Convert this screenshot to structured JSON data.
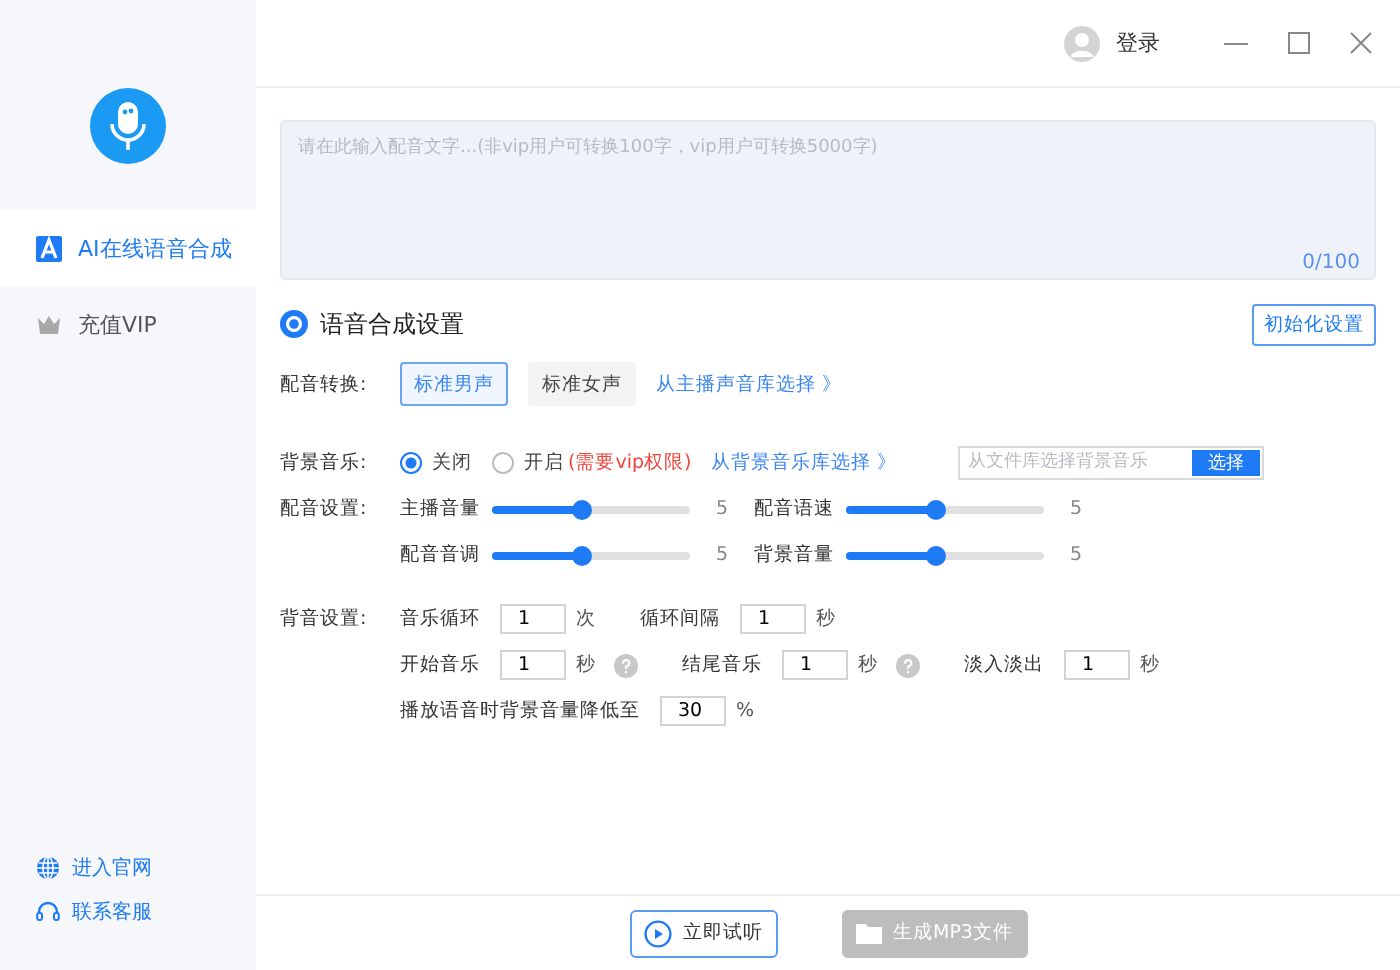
{
  "header": {
    "login": "登录"
  },
  "sidebar": {
    "items": [
      {
        "label": "AI在线语音合成",
        "selected": true,
        "kind": "ai"
      },
      {
        "label": "充值VIP",
        "selected": false,
        "kind": "vip"
      }
    ],
    "links": [
      {
        "label": "进入官网",
        "kind": "globe"
      },
      {
        "label": "联系客服",
        "kind": "headset"
      }
    ]
  },
  "editor": {
    "placeholder": "请在此输入配音文字...(非vip用户可转换100字，vip用户可转换5000字)",
    "counter": "0/100"
  },
  "settings": {
    "title": "语音合成设置",
    "reset": "初始化设置",
    "voice": {
      "label": "配音转换:",
      "options": [
        {
          "label": "标准男声",
          "selected": true
        },
        {
          "label": "标准女声",
          "selected": false
        }
      ],
      "link": "从主播声音库选择 》"
    },
    "music": {
      "label": "背景音乐:",
      "options": [
        {
          "label": "关闭",
          "selected": true
        },
        {
          "label": "开启",
          "selected": false,
          "note": "(需要vip权限)"
        }
      ],
      "link": "从背景音乐库选择 》",
      "file_placeholder": "从文件库选择背景音乐",
      "choose": "选择"
    },
    "mix": {
      "label": "配音设置:",
      "rows": [
        [
          {
            "name": "主播音量",
            "level": 0.45,
            "reading": "5"
          },
          {
            "name": "配音语速",
            "level": 0.45,
            "reading": "5"
          }
        ],
        [
          {
            "name": "配音音调",
            "level": 0.45,
            "reading": "5"
          },
          {
            "name": "背景音量",
            "level": 0.45,
            "reading": "5"
          }
        ]
      ]
    },
    "bg": {
      "label": "背音设置:",
      "rows": [
        [
          {
            "label": "音乐循环",
            "value": "1",
            "unit": "次",
            "help": false
          },
          {
            "label": "循环间隔",
            "value": "1",
            "unit": "秒",
            "help": false
          }
        ],
        [
          {
            "label": "开始音乐",
            "value": "1",
            "unit": "秒",
            "help": true
          },
          {
            "label": "结尾音乐",
            "value": "1",
            "unit": "秒",
            "help": true
          },
          {
            "label": "淡入淡出",
            "value": "1",
            "unit": "秒",
            "help": false
          }
        ],
        [
          {
            "label": "播放语音时背景音量降低至",
            "value": "30",
            "unit": "%",
            "help": false
          }
        ]
      ]
    }
  },
  "footer": {
    "preview": "立即试听",
    "generate": "生成MP3文件",
    "generate_disabled": true
  }
}
